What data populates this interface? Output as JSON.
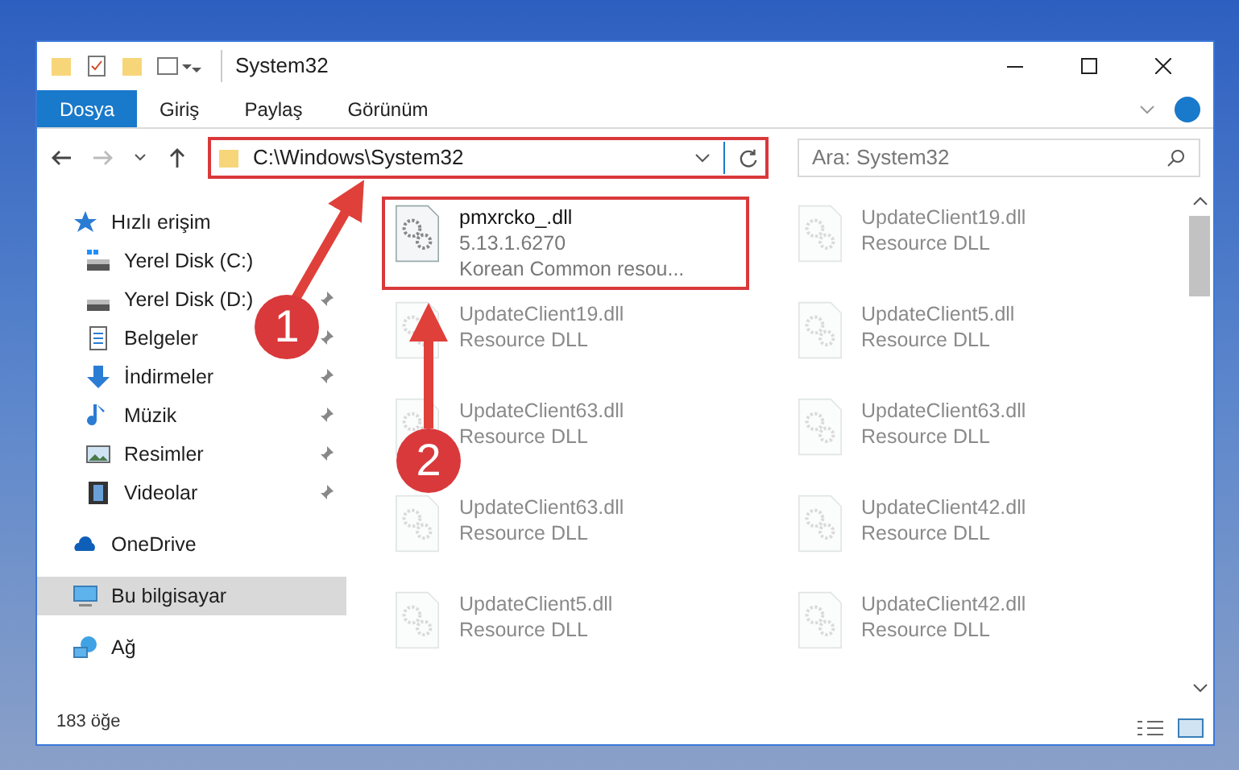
{
  "window": {
    "title": "System32"
  },
  "ribbon_tabs": [
    {
      "label": "Dosya",
      "selected": true
    },
    {
      "label": "Giriş",
      "selected": false
    },
    {
      "label": "Paylaş",
      "selected": false
    },
    {
      "label": "Görünüm",
      "selected": false
    }
  ],
  "address": {
    "path": "C:\\Windows\\System32",
    "highlighted": true
  },
  "search": {
    "placeholder": "Ara: System32"
  },
  "sidebar": {
    "items": [
      {
        "label": "Hızlı erişim",
        "pinned": false,
        "selected": false
      },
      {
        "label": "Yerel Disk (C:)",
        "pinned": false,
        "selected": false
      },
      {
        "label": "Yerel Disk (D:)",
        "pinned": true,
        "selected": false
      },
      {
        "label": "Belgeler",
        "pinned": true,
        "selected": false
      },
      {
        "label": "İndirmeler",
        "pinned": true,
        "selected": false
      },
      {
        "label": "Müzik",
        "pinned": true,
        "selected": false
      },
      {
        "label": "Resimler",
        "pinned": true,
        "selected": false
      },
      {
        "label": "Videolar",
        "pinned": true,
        "selected": false
      },
      {
        "label": "OneDrive",
        "pinned": false,
        "selected": false
      },
      {
        "label": "Bu bilgisayar",
        "pinned": false,
        "selected": true
      },
      {
        "label": "Ağ",
        "pinned": false,
        "selected": false
      }
    ]
  },
  "files": [
    {
      "name": "pmxrcko_.dll",
      "version": "5.13.1.6270",
      "description": "Korean Common resou...",
      "highlighted": true
    },
    {
      "name": "UpdateClient19.dll",
      "description": "Resource DLL",
      "highlighted": false
    },
    {
      "name": "UpdateClient19.dll",
      "description": "Resource DLL",
      "highlighted": false
    },
    {
      "name": "UpdateClient5.dll",
      "description": "Resource DLL",
      "highlighted": false
    },
    {
      "name": "UpdateClient63.dll",
      "description": "Resource DLL",
      "highlighted": false
    },
    {
      "name": "UpdateClient63.dll",
      "description": "Resource DLL",
      "highlighted": false
    },
    {
      "name": "UpdateClient63.dll",
      "description": "Resource DLL",
      "highlighted": false
    },
    {
      "name": "UpdateClient42.dll",
      "description": "Resource DLL",
      "highlighted": false
    },
    {
      "name": "UpdateClient5.dll",
      "description": "Resource DLL",
      "highlighted": false
    },
    {
      "name": "UpdateClient42.dll",
      "description": "Resource DLL",
      "highlighted": false
    }
  ],
  "status_bar": {
    "count": "183 öğe"
  },
  "annotations": [
    "1",
    "2"
  ]
}
